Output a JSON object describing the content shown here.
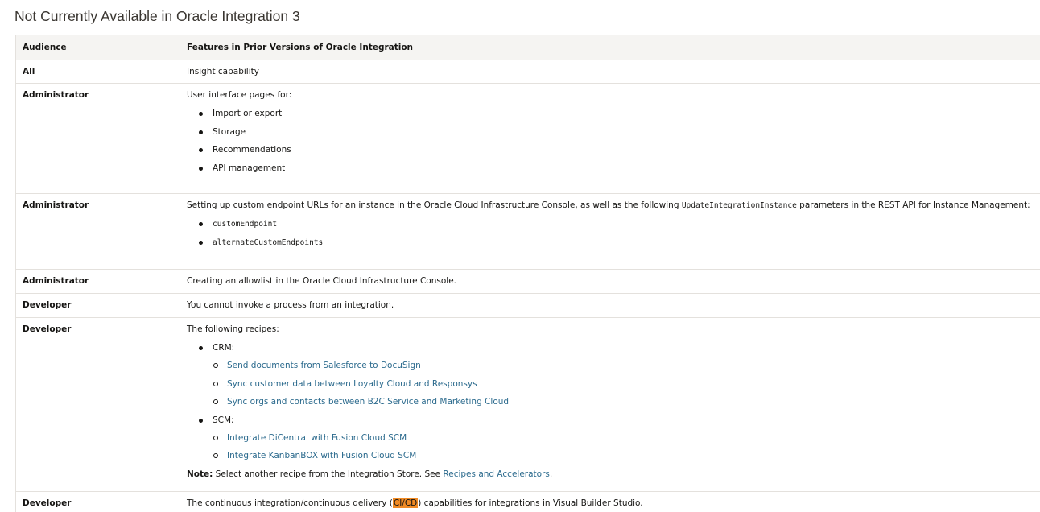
{
  "page": {
    "title": "Not Currently Available in Oracle Integration 3"
  },
  "table": {
    "headers": {
      "audience": "Audience",
      "features": "Features in Prior Versions of Oracle Integration"
    },
    "rows": [
      {
        "audience": "All",
        "text": "Insight capability"
      },
      {
        "audience": "Administrator",
        "intro": "User interface pages for:",
        "items": [
          "Import or export",
          "Storage",
          "Recommendations",
          "API management"
        ]
      },
      {
        "audience": "Administrator",
        "intro_before": "Setting up custom endpoint URLs for an instance in the Oracle Cloud Infrastructure Console, as well as the following ",
        "intro_code": "UpdateIntegrationInstance",
        "intro_after": " parameters in the REST API for Instance Management:",
        "items": [
          "customEndpoint",
          "alternateCustomEndpoints"
        ]
      },
      {
        "audience": "Administrator",
        "text": "Creating an allowlist in the Oracle Cloud Infrastructure Console."
      },
      {
        "audience": "Developer",
        "text": "You cannot invoke a process from an integration."
      },
      {
        "audience": "Developer",
        "intro": "The following recipes:",
        "groups": [
          {
            "label": "CRM:",
            "links": [
              "Send documents from Salesforce to DocuSign",
              "Sync customer data between Loyalty Cloud and Responsys",
              "Sync orgs and contacts between B2C Service and Marketing Cloud"
            ]
          },
          {
            "label": "SCM:",
            "links": [
              "Integrate DiCentral with Fusion Cloud SCM",
              "Integrate KanbanBOX with Fusion Cloud SCM"
            ]
          }
        ],
        "note_label": "Note:",
        "note_text": " Select another recipe from the Integration Store. See ",
        "note_link": "Recipes and Accelerators",
        "note_end": "."
      },
      {
        "audience": "Developer",
        "text_before": "The continuous integration/continuous delivery (",
        "highlight": "CI/CD",
        "text_after": ") capabilities for integrations in Visual Builder Studio."
      }
    ]
  },
  "colors": {
    "link": "#2b6a8d",
    "highlight": "#f08a24",
    "header_bg": "#f5f4f2",
    "border": "#e4e1dd"
  }
}
